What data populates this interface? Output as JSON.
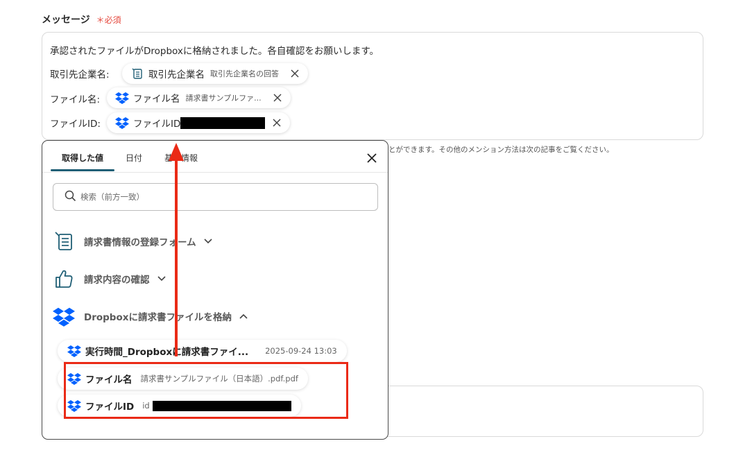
{
  "field": {
    "label": "メッセージ",
    "required_mark": "＊",
    "required_text": "必須"
  },
  "message": {
    "first_line": "承認されたファイルがDropboxに格納されました。各自確認をお願いします。",
    "rows": [
      {
        "label": "取引先企業名:",
        "chip_name": "取引先企業名",
        "chip_value": "取引先企業名の回答"
      },
      {
        "label": "ファイル名:",
        "chip_name": "ファイル名",
        "chip_value": "請求書サンプルファ..."
      },
      {
        "label": "ファイルID:",
        "chip_name": "ファイルID",
        "chip_value": ""
      }
    ]
  },
  "hint_text": "とができます。その他のメンション方法は次の記事をご覧ください。",
  "panel": {
    "tabs": [
      {
        "label": "取得した値"
      },
      {
        "label": "日付"
      },
      {
        "label": "基本情報"
      }
    ],
    "search_placeholder": "検索（前方一致）",
    "groups": [
      {
        "label": "請求書情報の登録フォーム",
        "icon": "form-icon",
        "expanded": false
      },
      {
        "label": "請求内容の確認",
        "icon": "thumbs-up-icon",
        "expanded": false
      },
      {
        "label": "Dropboxに請求書ファイルを格納",
        "icon": "dropbox-icon",
        "expanded": true
      }
    ],
    "items": [
      {
        "name": "実行時間_Dropboxに請求書ファイ...",
        "value": "2025-09-24 13:03"
      },
      {
        "name": "ファイル名",
        "value": "請求書サンプルファイル（日本語）.pdf.pdf"
      },
      {
        "name": "ファイルID",
        "value": "id"
      }
    ]
  },
  "colors": {
    "accent": "#1f5e75",
    "highlight": "#ea2a16",
    "dropbox": "#0061fe",
    "required": "#e5483d"
  }
}
